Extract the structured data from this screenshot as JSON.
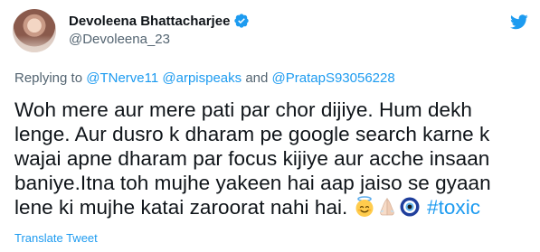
{
  "author": {
    "display_name": "Devoleena Bhattacharjee",
    "handle": "@Devoleena_23",
    "verified": true
  },
  "reply": {
    "prefix": "Replying to ",
    "mentions": [
      "@TNerve11",
      "@arpispeaks"
    ],
    "conjunction": "and",
    "last_mention": "@PratapS93056228"
  },
  "tweet": {
    "lines": [
      "Woh mere aur mere pati par chor dijiye. Hum dekh",
      "lenge. Aur dusro k dharam pe google search karne k",
      "wajai apne dharam par focus kijiye aur acche insaan",
      "baniye.Itna toh mujhe yakeen hai aap jaiso se gyaan",
      "lene ki mujhe katai zaroorat nahi hai."
    ],
    "emojis": [
      "smiling-face-with-halo",
      "folded-hands",
      "nazar-amulet"
    ],
    "hashtag": "#toxic"
  },
  "translate_label": "Translate Tweet",
  "colors": {
    "link": "#1d9bf0",
    "secondary_text": "#536471",
    "primary_text": "#0f1419"
  }
}
